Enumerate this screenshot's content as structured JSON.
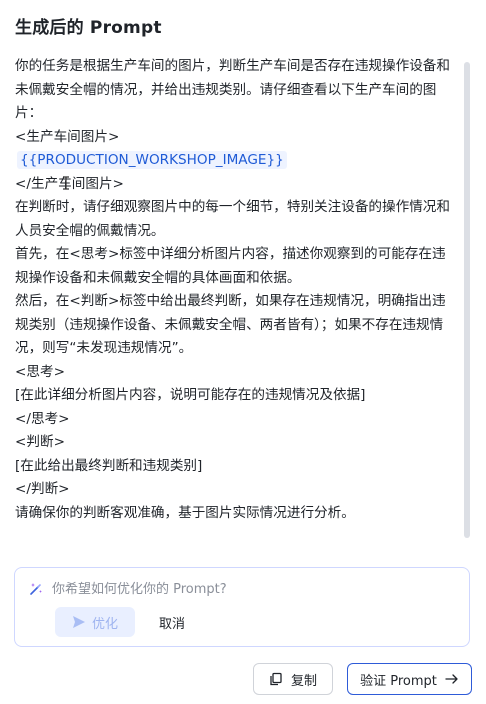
{
  "header": {
    "title": "生成后的 Prompt"
  },
  "prompt": {
    "lines": [
      "你的任务是根据生产车间的图片，判断生产车间是否存在违规操作设备和未佩戴安全帽的情况，并给出违规类别。请仔细查看以下生产车间的图片：",
      "<生产车间图片>",
      "{{PRODUCTION_WORKSHOP_IMAGE}}",
      "</生产车间图片>",
      "在判断时，请仔细观察图片中的每一个细节，特别关注设备的操作情况和人员安全帽的佩戴情况。",
      "首先，在<思考>标签中详细分析图片内容，描述你观察到的可能存在违规操作设备和未佩戴安全帽的具体画面和依据。",
      "然后，在<判断>标签中给出最终判断，如果存在违规情况，明确指出违规类别（违规操作设备、未佩戴安全帽、两者皆有）；如果不存在违规情况，则写“未发现违规情况”。",
      "<思考>",
      "[在此详细分析图片内容，说明可能存在的违规情况及依据]",
      "</思考>",
      "<判断>",
      "[在此给出最终判断和违规类别]",
      "</判断>",
      "请确保你的判断客观准确，基于图片实际情况进行分析。"
    ]
  },
  "optimize": {
    "placeholder": "你希望如何优化你的 Prompt?",
    "optimize_label": "优化",
    "cancel_label": "取消"
  },
  "footer": {
    "copy_label": "复制",
    "verify_label": "验证 Prompt"
  },
  "colors": {
    "accent": "#2e5bd8",
    "variable": "#1f5bd6"
  },
  "icons": {
    "optimize": "sparkle-pen-icon",
    "send": "send-icon",
    "copy": "copy-icon",
    "arrow": "arrow-right-icon"
  }
}
